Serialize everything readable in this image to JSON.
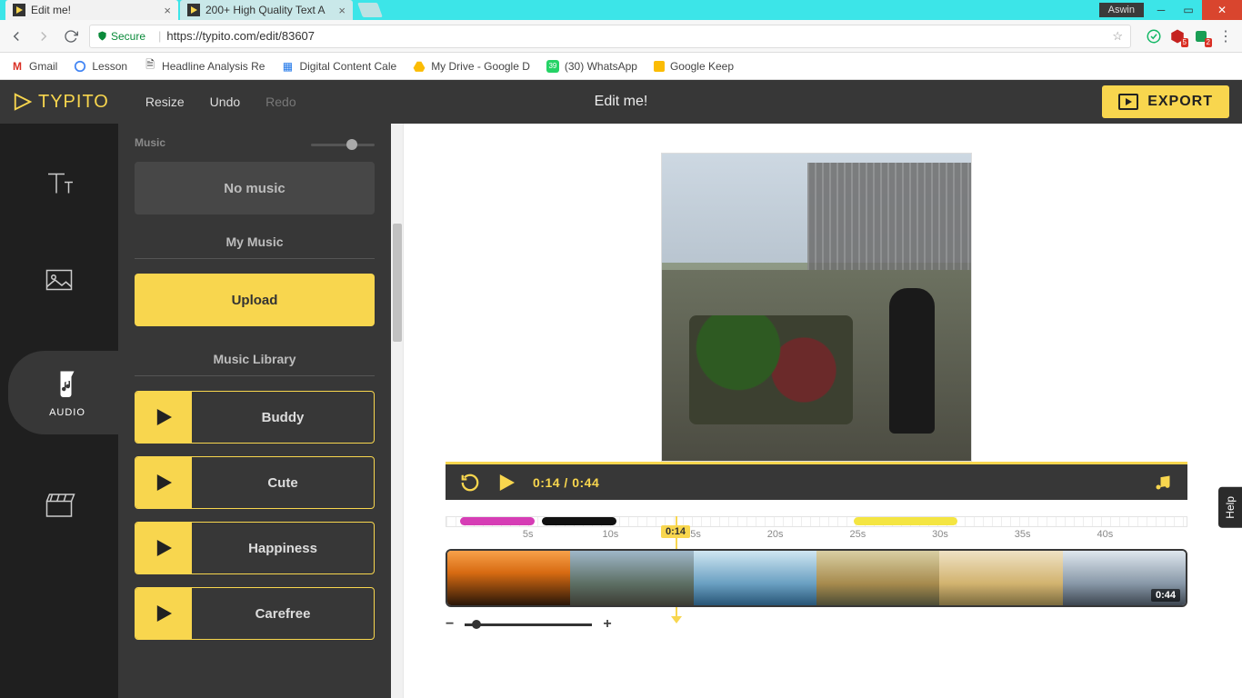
{
  "window": {
    "user": "Aswin",
    "tabs": [
      {
        "title": "Edit me!",
        "active": true
      },
      {
        "title": "200+ High Quality Text A",
        "active": false
      }
    ]
  },
  "browser": {
    "secure_label": "Secure",
    "url": "https://typito.com/edit/83607",
    "bookmarks": [
      "Gmail",
      "Lesson",
      "Headline Analysis Re",
      "Digital Content Cale",
      "My Drive - Google D",
      "(30) WhatsApp",
      "Google Keep"
    ],
    "ext_badges": [
      "5",
      "2"
    ]
  },
  "app": {
    "brand": "TYPITO",
    "menu": {
      "resize": "Resize",
      "undo": "Undo",
      "redo": "Redo"
    },
    "title": "Edit me!",
    "export": "EXPORT",
    "help": "Help"
  },
  "rail": {
    "text": "TEXT",
    "image": "IMAGE",
    "audio": "AUDIO",
    "video": "VIDEO",
    "active": "audio"
  },
  "panel": {
    "music_label": "Music",
    "no_music": "No music",
    "my_music": "My Music",
    "upload": "Upload",
    "library": "Music Library",
    "tracks": [
      "Buddy",
      "Cute",
      "Happiness",
      "Carefree"
    ]
  },
  "player": {
    "current": "0:14",
    "total": "0:44"
  },
  "timeline": {
    "ticks": [
      "5s",
      "10s",
      "15s",
      "20s",
      "25s",
      "30s",
      "35s",
      "40s"
    ],
    "playhead": "0:14",
    "duration": "0:44",
    "clips": [
      {
        "start_pct": 2,
        "width_pct": 10,
        "color": "#d63db5"
      },
      {
        "start_pct": 13,
        "width_pct": 10,
        "color": "#111"
      },
      {
        "start_pct": 55,
        "width_pct": 14,
        "color": "#f4e542"
      }
    ]
  }
}
